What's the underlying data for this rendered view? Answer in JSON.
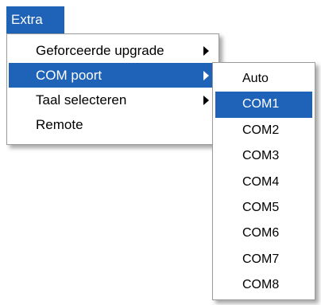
{
  "menubar": {
    "title": "Extra"
  },
  "menu": {
    "items": [
      {
        "label": "Geforceerde upgrade",
        "has_submenu": true,
        "highlighted": false
      },
      {
        "label": "COM poort",
        "has_submenu": true,
        "highlighted": true
      },
      {
        "label": "Taal selecteren",
        "has_submenu": true,
        "highlighted": false
      },
      {
        "label": "Remote",
        "has_submenu": false,
        "highlighted": false
      }
    ]
  },
  "submenu": {
    "items": [
      {
        "label": "Auto",
        "highlighted": false
      },
      {
        "label": "COM1",
        "highlighted": true
      },
      {
        "label": "COM2",
        "highlighted": false
      },
      {
        "label": "COM3",
        "highlighted": false
      },
      {
        "label": "COM4",
        "highlighted": false
      },
      {
        "label": "COM5",
        "highlighted": false
      },
      {
        "label": "COM6",
        "highlighted": false
      },
      {
        "label": "COM7",
        "highlighted": false
      },
      {
        "label": "COM8",
        "highlighted": false
      }
    ]
  },
  "colors": {
    "highlight": "#1f63b9",
    "menu_background": "#ffffff",
    "menu_border": "#9a9a9a"
  }
}
